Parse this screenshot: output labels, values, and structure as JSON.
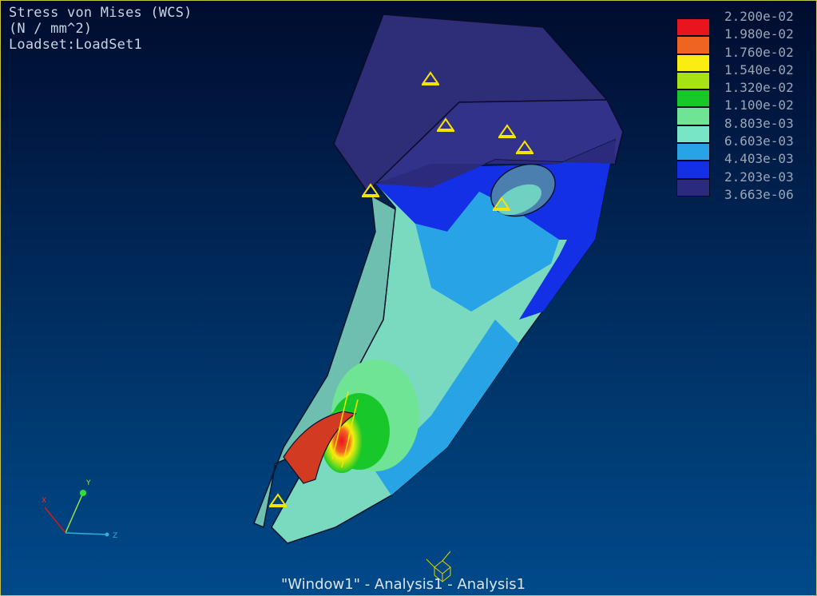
{
  "header": {
    "title": "Stress von Mises (WCS)",
    "units": "(N / mm^2)",
    "loadset": "Loadset:LoadSet1"
  },
  "legend": {
    "entries": [
      {
        "value": "2.200e-02",
        "color": "#e8151e"
      },
      {
        "value": "1.980e-02",
        "color": "#f06422"
      },
      {
        "value": "1.760e-02",
        "color": "#f9ee10"
      },
      {
        "value": "1.540e-02",
        "color": "#a6e214"
      },
      {
        "value": "1.320e-02",
        "color": "#18c82a"
      },
      {
        "value": "1.100e-02",
        "color": "#6fe494"
      },
      {
        "value": "8.803e-03",
        "color": "#78e6c6"
      },
      {
        "value": "6.603e-03",
        "color": "#28a3e6"
      },
      {
        "value": "4.403e-03",
        "color": "#1430e6"
      },
      {
        "value": "2.203e-03",
        "color": "#2c2a7c"
      }
    ],
    "min_value": "3.663e-06"
  },
  "triad": {
    "x": "X",
    "y": "Y",
    "z": "Z"
  },
  "footer": {
    "text": "\"Window1\" - Analysis1 - Analysis1"
  }
}
